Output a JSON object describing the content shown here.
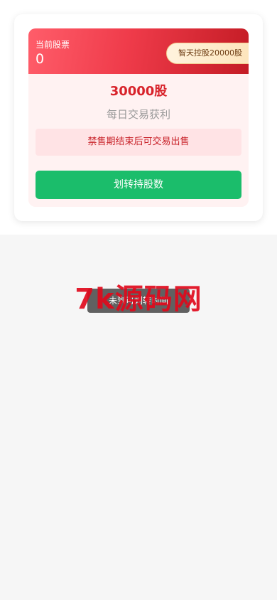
{
  "holding": {
    "label": "当前股票",
    "value": "0",
    "badge": "智天控股20000股"
  },
  "offer": {
    "amount": "30000股",
    "subtitle": "每日交易获利",
    "notice": "禁售期结束后可交易出售"
  },
  "actions": {
    "transfer_label": "划转持股数"
  },
  "toast": {
    "message": "未到可划转时间"
  },
  "watermark": {
    "text": "7k源码网"
  },
  "colors": {
    "header_start": "#ff5d6a",
    "header_end": "#c41c25",
    "accent_red": "#d8232b",
    "button_green": "#1bbd6b",
    "panel_bg": "#fff2f2"
  }
}
